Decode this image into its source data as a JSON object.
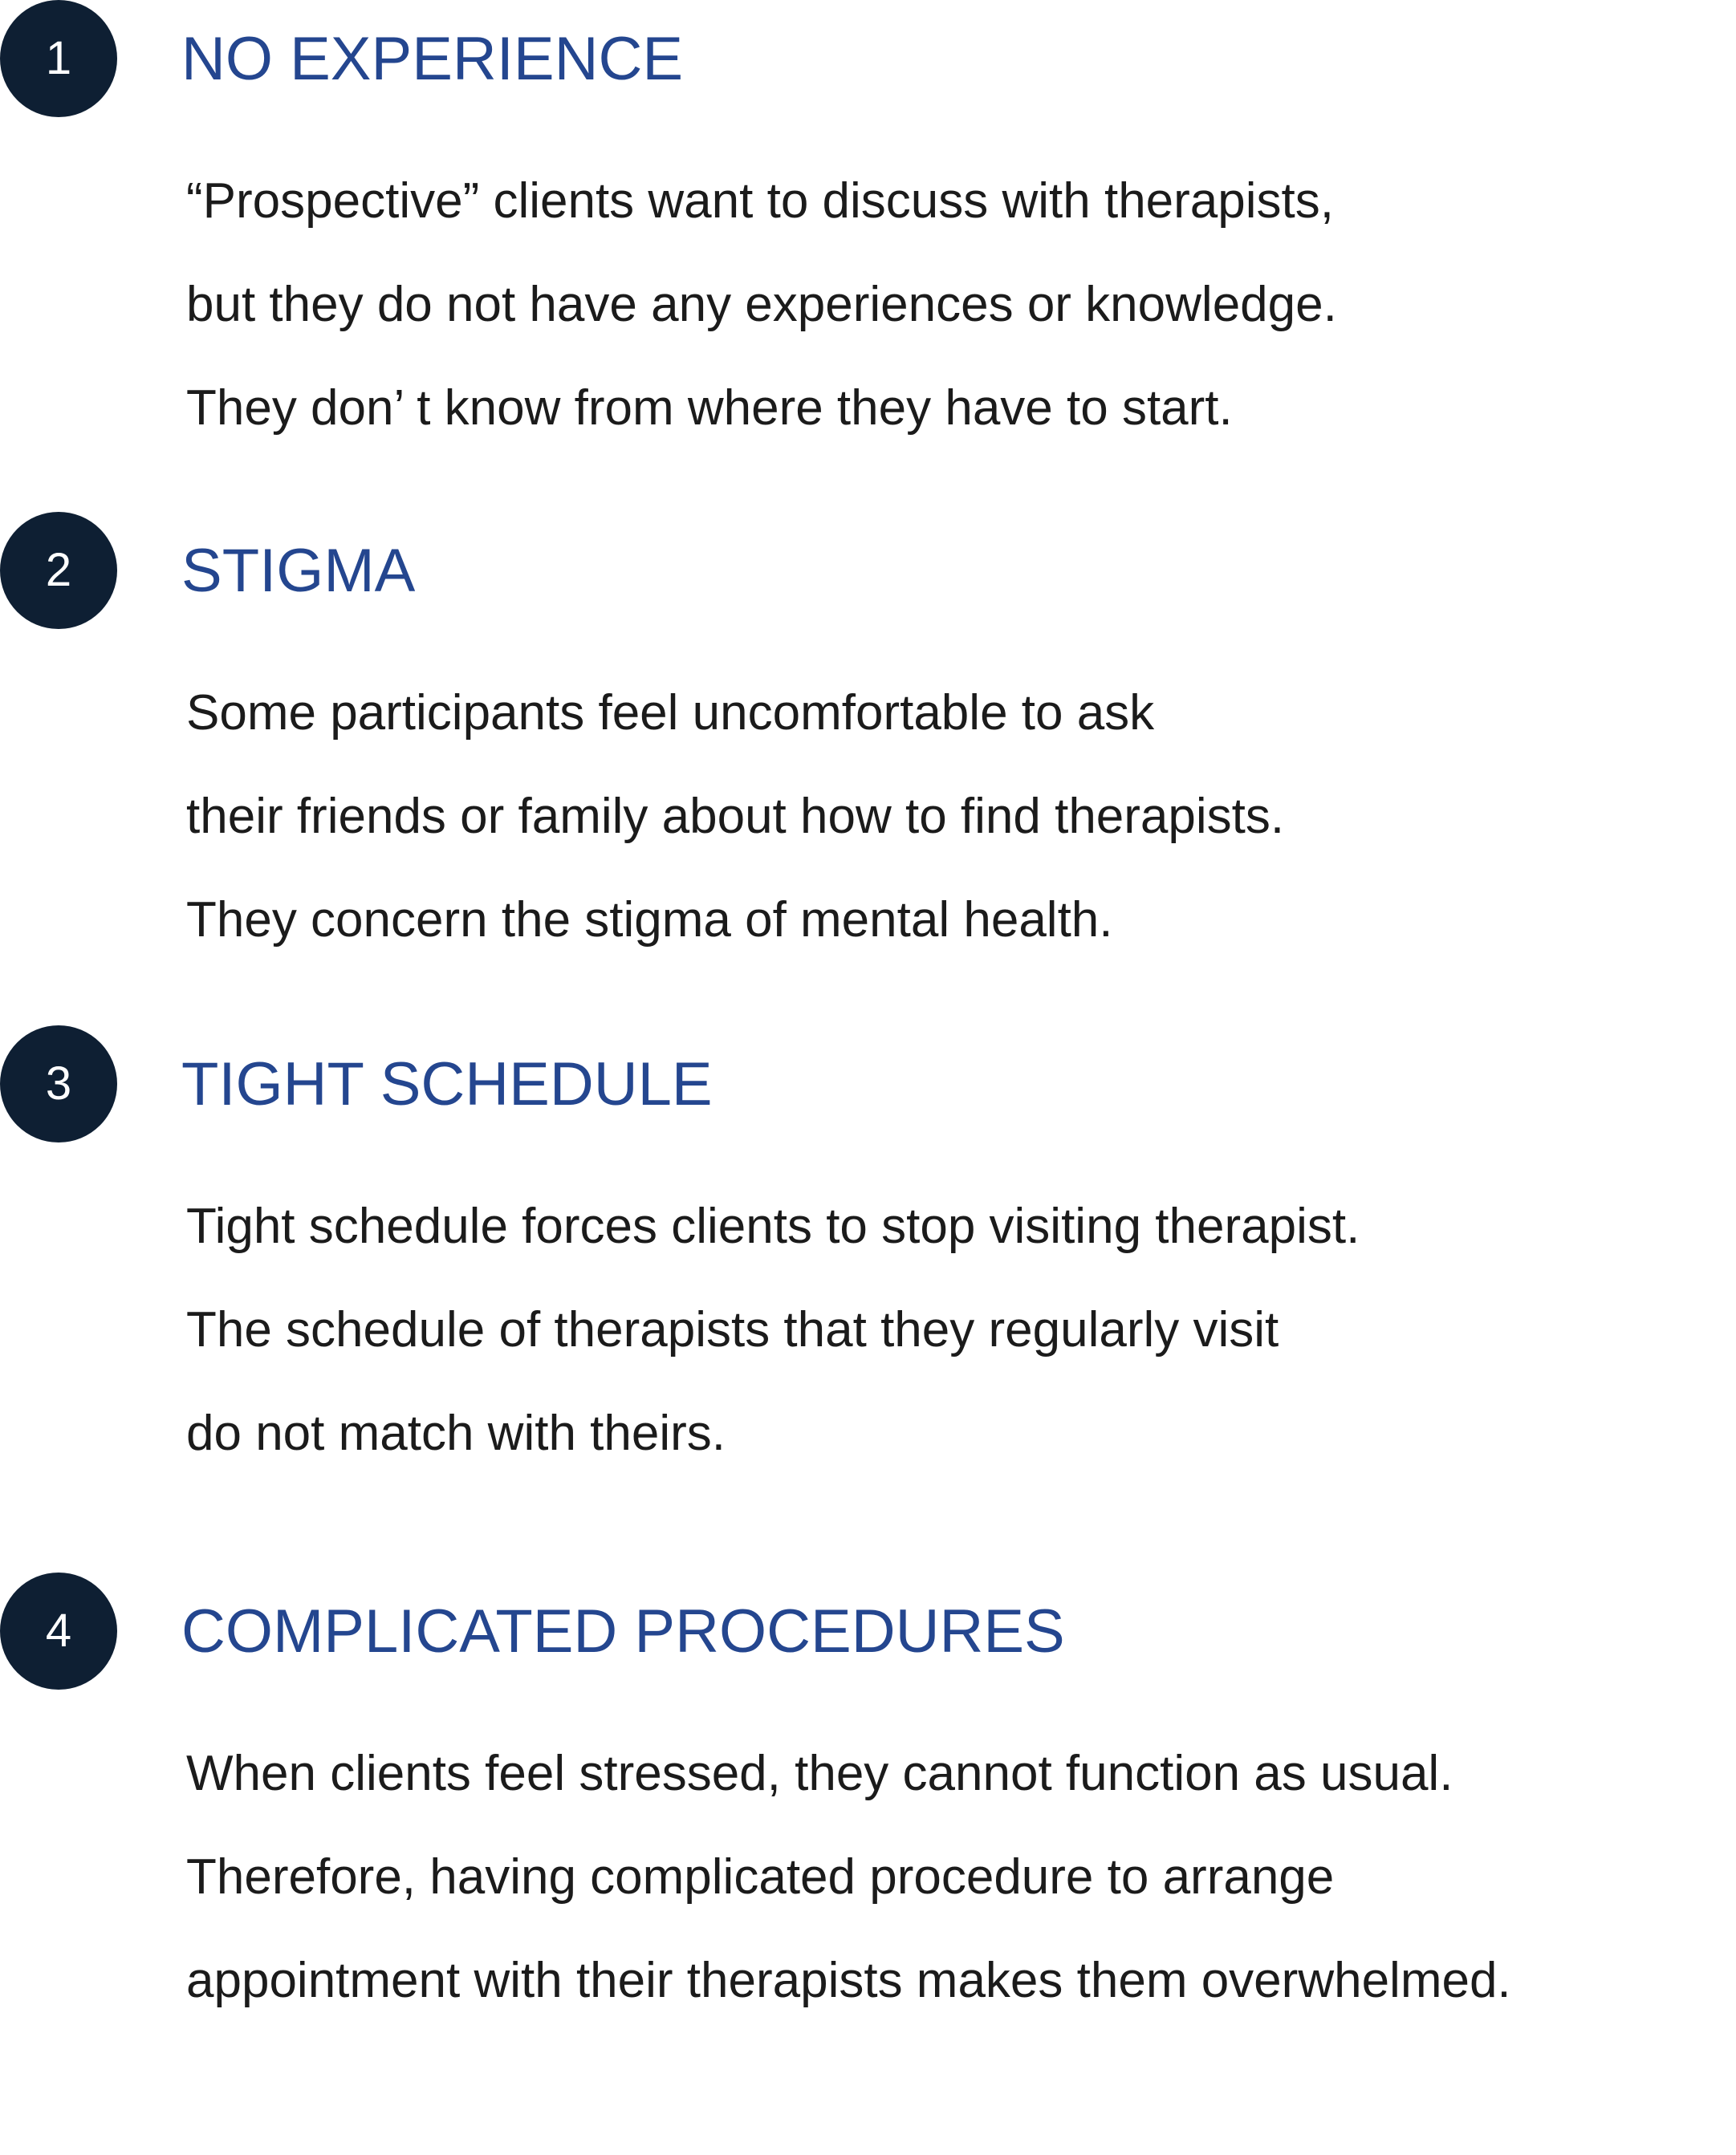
{
  "items": [
    {
      "number": "1",
      "title": "NO EXPERIENCE",
      "lines": [
        "“Prospective” clients want to discuss with therapists,",
        "but they do not have any experiences or knowledge.",
        "They don’ t know from where they have to start."
      ]
    },
    {
      "number": "2",
      "title": "STIGMA",
      "lines": [
        "Some participants feel uncomfortable to ask",
        "their friends or family about how to find therapists.",
        "They concern the stigma of mental health."
      ]
    },
    {
      "number": "3",
      "title": "TIGHT SCHEDULE",
      "lines": [
        "Tight schedule forces clients to stop visiting therapist.",
        "The schedule of therapists that they regularly visit",
        "do not match with theirs."
      ]
    },
    {
      "number": "4",
      "title": "COMPLICATED PROCEDURES",
      "lines": [
        "When clients feel stressed, they cannot function as usual.",
        "Therefore, having complicated procedure to arrange",
        "appointment with their therapists makes them overwhelmed."
      ]
    }
  ]
}
